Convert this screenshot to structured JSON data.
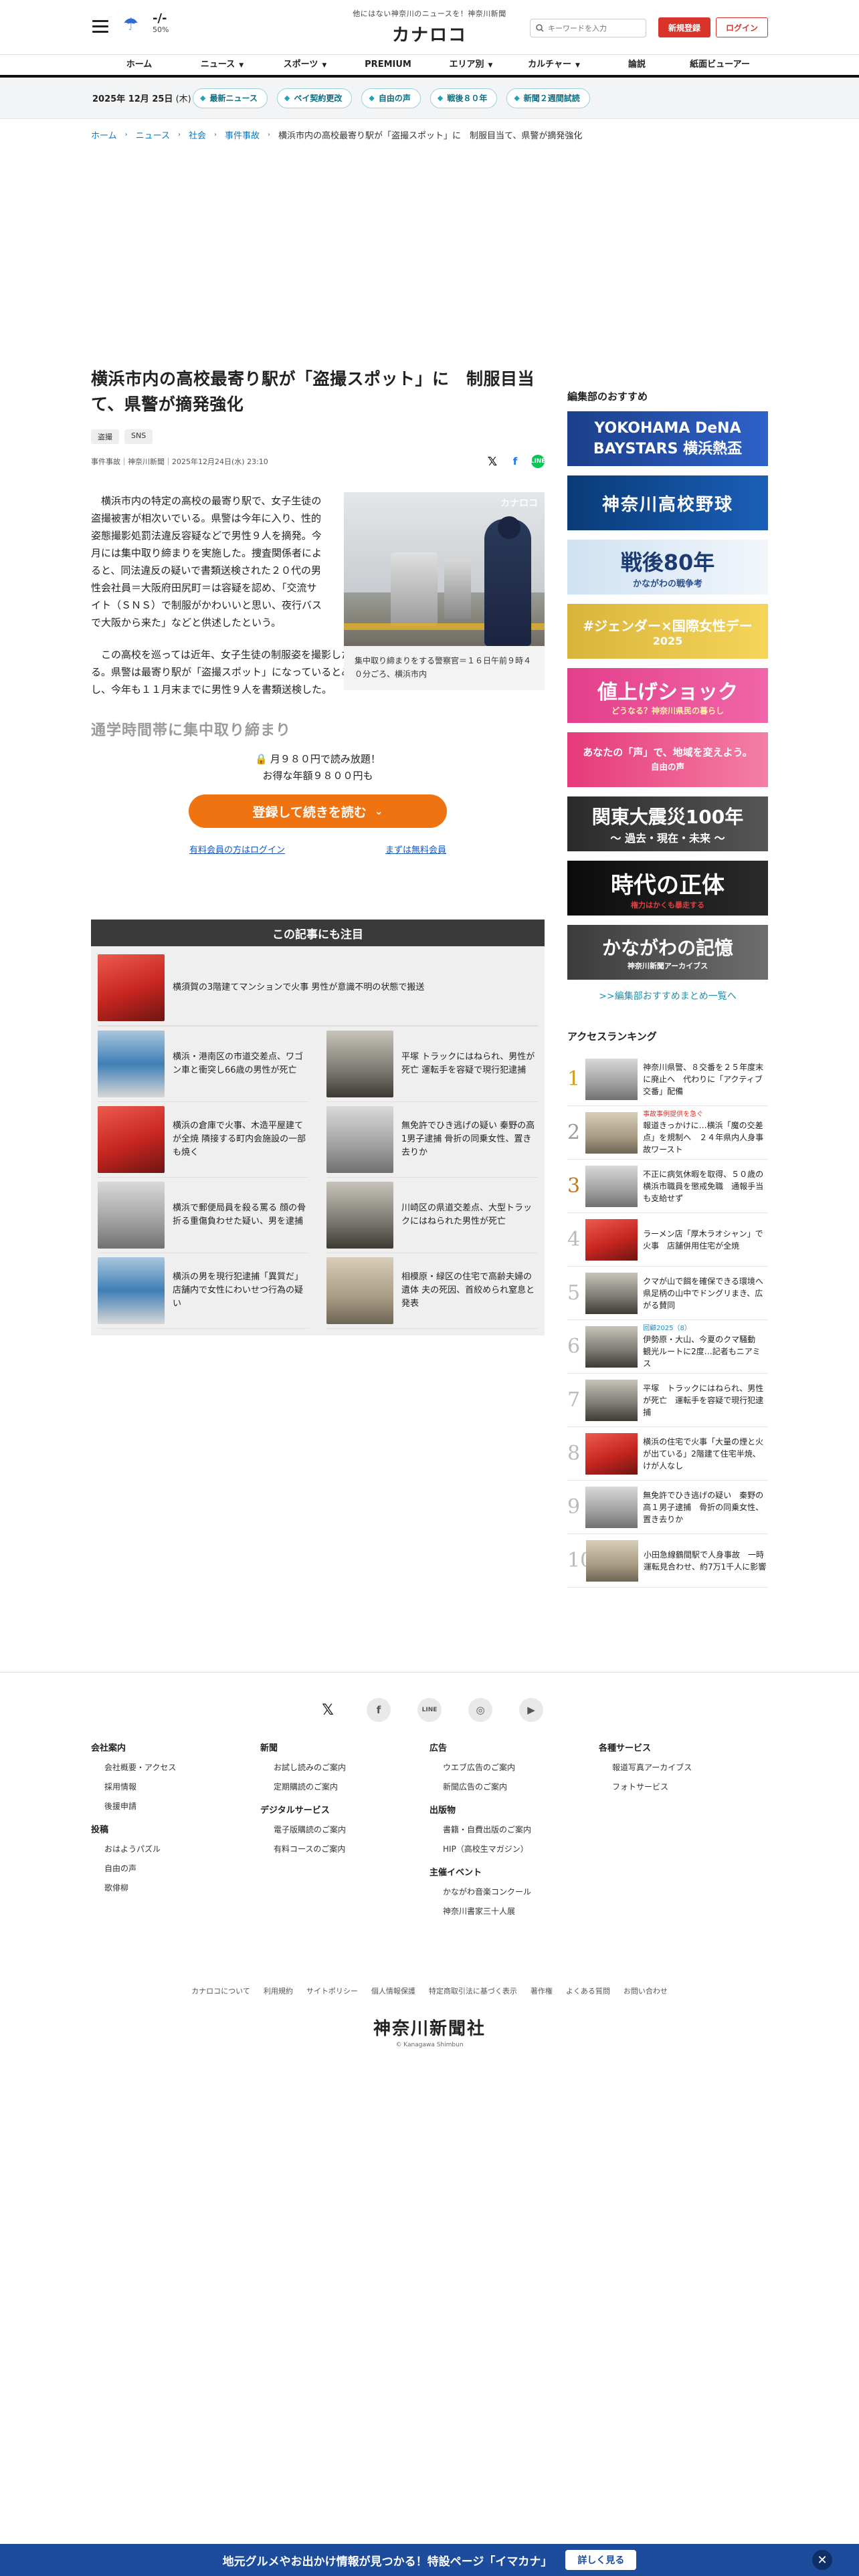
{
  "header": {
    "tagline": "他にはない神奈川のニュースを！神奈川新聞",
    "logo": "カナロコ",
    "weather": {
      "hi": "-/-",
      "lo": "50%"
    },
    "search_placeholder": "キーワードを入力",
    "register_label": "新規登録",
    "login_label": "ログイン"
  },
  "nav": [
    "ホーム",
    "ニュース",
    "スポーツ",
    "PREMIUM",
    "エリア別",
    "カルチャー",
    "論説",
    "紙面ビューアー"
  ],
  "subbar": {
    "date": "2025年 12月 25日",
    "weekday": "(木)",
    "chips": [
      "最新ニュース",
      "ペイ契約更改",
      "自由の声",
      "戦後８０年",
      "新聞２週間試読"
    ]
  },
  "breadcrumbs": [
    "ホーム",
    "ニュース",
    "社会",
    "事件事故",
    "横浜市内の高校最寄り駅が「盗撮スポット」に　制服目当て、県警が摘発強化"
  ],
  "article": {
    "title": "横浜市内の高校最寄り駅が「盗撮スポット」に　制服目当て、県警が摘発強化",
    "tags": [
      "盗撮",
      "SNS"
    ],
    "meta": "事件事故｜神奈川新聞｜2025年12月24日(水) 23:10",
    "p1": "横浜市内の特定の高校の最寄り駅で、女子生徒の盗撮被害が相次いでいる。県警は今年に入り、性的姿態撮影処罰法違反容疑などで男性９人を摘発。今月には集中取り締まりを実施した。捜査関係者によると、同法違反の疑いで書類送検された２０代の男性会社員＝大阪府田尻町＝は容疑を認め、「交流サイト（ＳＮＳ）で制服がかわいいと思い、夜行バスで大阪から来た」などと供述したという。",
    "p2": "この高校を巡っては近年、女子生徒の制服姿を撮影した動画や写真の投稿がＳＮＳで目立っている。県警は最寄り駅が「盗撮スポット」になっているとみて警戒を強化。昨年は男性７人を書類送検し、今年も１１月末までに男性９人を書類送検した。",
    "photo_watermark": "カナロコ",
    "caption": "集中取り締まりをする警察官＝１６日午前９時４０分ごろ、横浜市内",
    "fade_heading": "通学時間帯に集中取り締まり"
  },
  "paywall": {
    "line1": "月９８０円で読み放題！",
    "line2": "お得な年額９８００円も",
    "cta": "登録して続きを読む",
    "login_link": "有料会員の方はログイン",
    "free_link": "まずは無料会員"
  },
  "related": {
    "heading": "この記事にも注目",
    "first": "横須賀の3階建てマンションで火事 男性が意識不明の状態で搬送",
    "items": [
      "横浜・港南区の市道交差点、ワゴン車と衝突し66歳の男性が死亡",
      "平塚 トラックにはねられ、男性が死亡 運転手を容疑で現行犯逮捕",
      "横浜の倉庫で火事、木造平屋建て が全焼 隣接する町内会施設の一部も焼く",
      "無免許でひき逃げの疑い 秦野の高1男子逮捕 骨折の同乗女性、置き去りか",
      "横浜で郵便局員を殺る罵る 顔の骨折る重傷負わせた疑い、男を逮捕",
      "川崎区の県道交差点、大型トラックにはねられた男性が死亡",
      "横浜の男を現行犯逮捕「異質だ」 店舗内で女性にわいせつ行為の疑い",
      "相模原・緑区の住宅で高齢夫婦の遺体 夫の死因、首絞められ窒息と発表"
    ]
  },
  "sidebar": {
    "heading": "編集部のおすすめ",
    "banners": [
      {
        "main": "YOKOHAMA DeNA BAYSTARS 横浜熱盃",
        "sub": ""
      },
      {
        "main": "神奈川高校野球",
        "sub": ""
      },
      {
        "main": "戦後80年",
        "sub": "かながわの戦争考"
      },
      {
        "main": "#ジェンダー×国際女性デー",
        "sub": "2025"
      },
      {
        "main": "値上げショック",
        "sub": "どうなる？神奈川県民の暮らし"
      },
      {
        "main": "あなたの「声」で、地域を変えよう。",
        "sub": "自由の声"
      },
      {
        "main": "関東大震災100年",
        "sub": "〜 過去・現在・未来 〜"
      },
      {
        "main": "時代の正体",
        "sub": "権力はかくも暴走する"
      },
      {
        "main": "かながわの記憶",
        "sub": "神奈川新聞アーカイブス"
      }
    ],
    "more": ">>編集部おすすめまとめ一覧へ"
  },
  "ranking": {
    "heading": "アクセスランキング",
    "items": [
      {
        "no": "1",
        "label": "",
        "text": "神奈川県警、８交番を２５年度末に廃止へ　代わりに「アクティブ交番」配備"
      },
      {
        "no": "2",
        "label": "事故事例提供を急ぐ",
        "text": "報道きっかけに…横浜「魔の交差点」を規制へ　２４年県内人身事故ワースト"
      },
      {
        "no": "3",
        "label": "",
        "text": "不正に病気休暇を取得、５０歳の横浜市職員を懲戒免職　通報手当も支給せず"
      },
      {
        "no": "4",
        "label": "",
        "text": "ラーメン店「厚木ラオシャン」で火事　店舗併用住宅が全焼"
      },
      {
        "no": "5",
        "label": "",
        "text": "クマが山で餌を確保できる環境へ　県足柄の山中でドングリまき、広がる賛同"
      },
      {
        "no": "6",
        "label": "回顧2025（8）",
        "text": "伊勢原・大山、今夏のクマ騒動　観光ルートに2度…記者もニアミス"
      },
      {
        "no": "7",
        "label": "",
        "text": "平塚　トラックにはねられ、男性が死亡　運転手を容疑で現行犯逮捕"
      },
      {
        "no": "8",
        "label": "",
        "text": "横浜の住宅で火事「大量の煙と火が出ている」2階建て住宅半焼、けが人なし"
      },
      {
        "no": "9",
        "label": "",
        "text": "無免許でひき逃げの疑い　秦野の高１男子逮捕　骨折の同乗女性、置き去りか"
      },
      {
        "no": "10",
        "label": "",
        "text": "小田急線鶴間駅で人身事故　一時運転見合わせ、約7万1千人に影響"
      }
    ]
  },
  "footer": {
    "cols": [
      {
        "groups": [
          {
            "h": "会社案内",
            "links": [
              "会社概要・アクセス",
              "採用情報",
              "後援申請"
            ]
          },
          {
            "h": "投稿",
            "links": [
              "おはようパズル",
              "自由の声",
              "歌俳柳"
            ]
          }
        ]
      },
      {
        "groups": [
          {
            "h": "新聞",
            "links": [
              "お試し読みのご案内",
              "定期購読のご案内"
            ]
          },
          {
            "h": "デジタルサービス",
            "links": [
              "電子版購読のご案内",
              "有料コースのご案内"
            ]
          }
        ]
      },
      {
        "groups": [
          {
            "h": "広告",
            "links": [
              "ウエブ広告のご案内",
              "新聞広告のご案内"
            ]
          },
          {
            "h": "出版物",
            "links": [
              "書籍・自費出版のご案内",
              "HIP（高校生マガジン）"
            ]
          },
          {
            "h": "主催イベント",
            "links": [
              "かながわ音楽コンクール",
              "神奈川書家三十人展"
            ]
          }
        ]
      },
      {
        "groups": [
          {
            "h": "各種サービス",
            "links": [
              "報道写真アーカイブス",
              "フォトサービス"
            ]
          }
        ]
      }
    ],
    "links": [
      "カナロコについて",
      "利用規約",
      "サイトポリシー",
      "個人情報保護",
      "特定商取引法に基づく表示",
      "著作権",
      "よくある質問",
      "お問い合わせ"
    ],
    "logo": "神奈川新聞社",
    "copyright": "© Kanagawa Shimbun"
  },
  "bottom_bar": {
    "text": "地元グルメやお出かけ情報が見つかる！特設ページ「イマカナ」",
    "button": "詳しく見る"
  }
}
